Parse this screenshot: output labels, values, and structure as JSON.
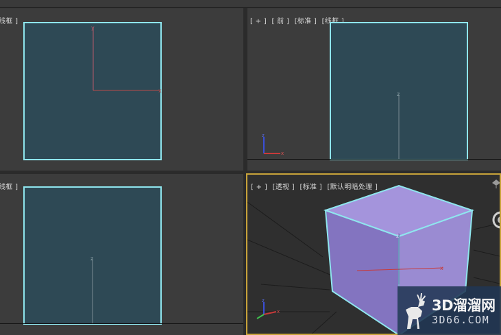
{
  "viewports": {
    "top_left": {
      "labels": [
        "线框 ]"
      ],
      "axes": {
        "y": "y",
        "x": "x"
      }
    },
    "top_right": {
      "labels": [
        "[ + ]",
        "[ 前 ]",
        "[标准 ]",
        "[线框 ]"
      ],
      "axes": {
        "z": "z"
      },
      "gizmo": {
        "z": "z",
        "x": "x"
      }
    },
    "bottom_left": {
      "labels": [
        "线框 ]"
      ],
      "axes": {
        "z": "z"
      }
    },
    "bottom_right": {
      "labels": [
        "[ + ]",
        "[透视 ]",
        "[标准 ]",
        "[默认明暗处理 ]"
      ],
      "axes": {
        "z": "z",
        "x": "x"
      },
      "gizmo": {
        "z": "z",
        "x": "x"
      }
    }
  },
  "watermark": {
    "title": "3D溜溜网",
    "subtitle": "3D66.COM"
  },
  "colors": {
    "accent_cyan": "#8fe6ee",
    "plane_fill": "#2e4955",
    "cube_top": "#a494dc",
    "cube_front": "#8374c0",
    "cube_side": "#9a8bd2",
    "active_border": "#c8a33a",
    "axis_red": "#c83a3a",
    "axis_blue": "#3a4fd8",
    "axis_green": "#3fc24f"
  },
  "icons": [
    "deer-logo-icon",
    "orbit-icon",
    "viewcube-icon"
  ]
}
